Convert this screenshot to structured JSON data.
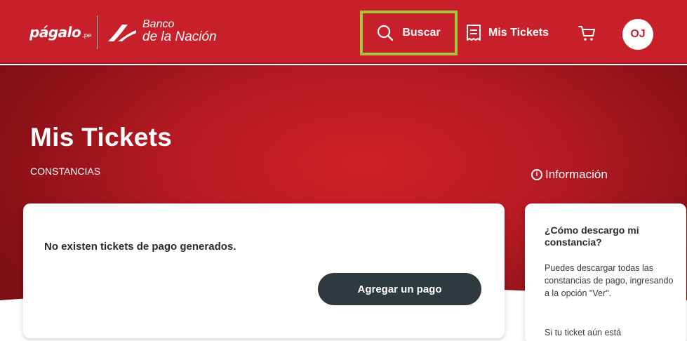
{
  "header": {
    "logo_text": "págalo",
    "logo_suffix": ".pe",
    "bank_line1": "Banco",
    "bank_line2": "de la Nación",
    "search_label": "Buscar",
    "tickets_label": "Mis Tickets",
    "avatar_initials": "OJ",
    "highlight_color": "#a6c43a",
    "brand_color": "#c8202a"
  },
  "hero": {
    "title": "Mis Tickets",
    "subtitle": "CONSTANCIAS",
    "info_label": "Información"
  },
  "main_card": {
    "empty_message": "No existen tickets de pago generados.",
    "add_button": "Agregar un pago"
  },
  "side_card": {
    "title": "¿Cómo descargo mi constancia?",
    "paragraph1": "Puedes descargar todas las constancias de pago, ingresando a la opción \"Ver\".",
    "paragraph2": "Si tu ticket aún está"
  },
  "icons": {
    "search": "search-icon",
    "tickets": "receipt-icon",
    "cart": "cart-icon",
    "info": "info-icon"
  }
}
